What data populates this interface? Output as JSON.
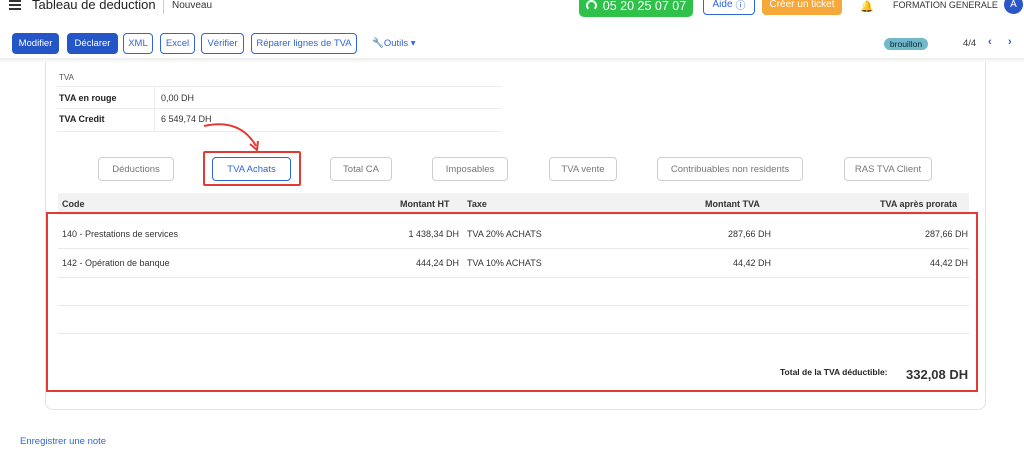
{
  "header": {
    "title": "Tableau de deduction",
    "subtitle": "Nouveau",
    "phone": "05 20 25 07 07",
    "help_label": "Aide",
    "ticket_label": "Créer un ticket",
    "company": "FORMATION GENERALE",
    "avatar_letter": "A"
  },
  "toolbar": {
    "buttons": [
      "Modifier",
      "Déclarer",
      "XML",
      "Excel",
      "Vérifier",
      "Réparer lignes de TVA"
    ],
    "tools_label": "Outils",
    "status_badge": "brouillon",
    "pager": "4/4"
  },
  "summary": {
    "section_label": "TVA",
    "rows": [
      {
        "label": "TVA en rouge",
        "value": "0,00 DH"
      },
      {
        "label": "TVA Credit",
        "value": "6 549,74 DH"
      }
    ]
  },
  "tabs": [
    "Déductions",
    "TVA Achats",
    "Total CA",
    "Imposables",
    "TVA vente",
    "Contribuables non residents",
    "RAS TVA Client"
  ],
  "active_tab": "TVA Achats",
  "table": {
    "columns": [
      "Code",
      "Montant HT",
      "Taxe",
      "Montant TVA",
      "TVA après prorata"
    ],
    "rows": [
      {
        "code": "140 - Prestations de services",
        "montant_ht": "1 438,34 DH",
        "taxe": "TVA 20% ACHATS",
        "montant_tva": "287,66 DH",
        "tva_prorata": "287,66 DH"
      },
      {
        "code": "142 - Opération de banque",
        "montant_ht": "444,24 DH",
        "taxe": "TVA 10% ACHATS",
        "montant_tva": "44,42 DH",
        "tva_prorata": "44,42 DH"
      }
    ],
    "total_label": "Total de la TVA déductible:",
    "total_value": "332,08 DH"
  },
  "footer": {
    "note_link": "Enregistrer une note"
  },
  "colors": {
    "primary": "#2456c8",
    "phone_green": "#2fc24a",
    "ticket_orange": "#f6a83a",
    "highlight_red": "#e53935",
    "badge_teal": "#71b9c8"
  }
}
